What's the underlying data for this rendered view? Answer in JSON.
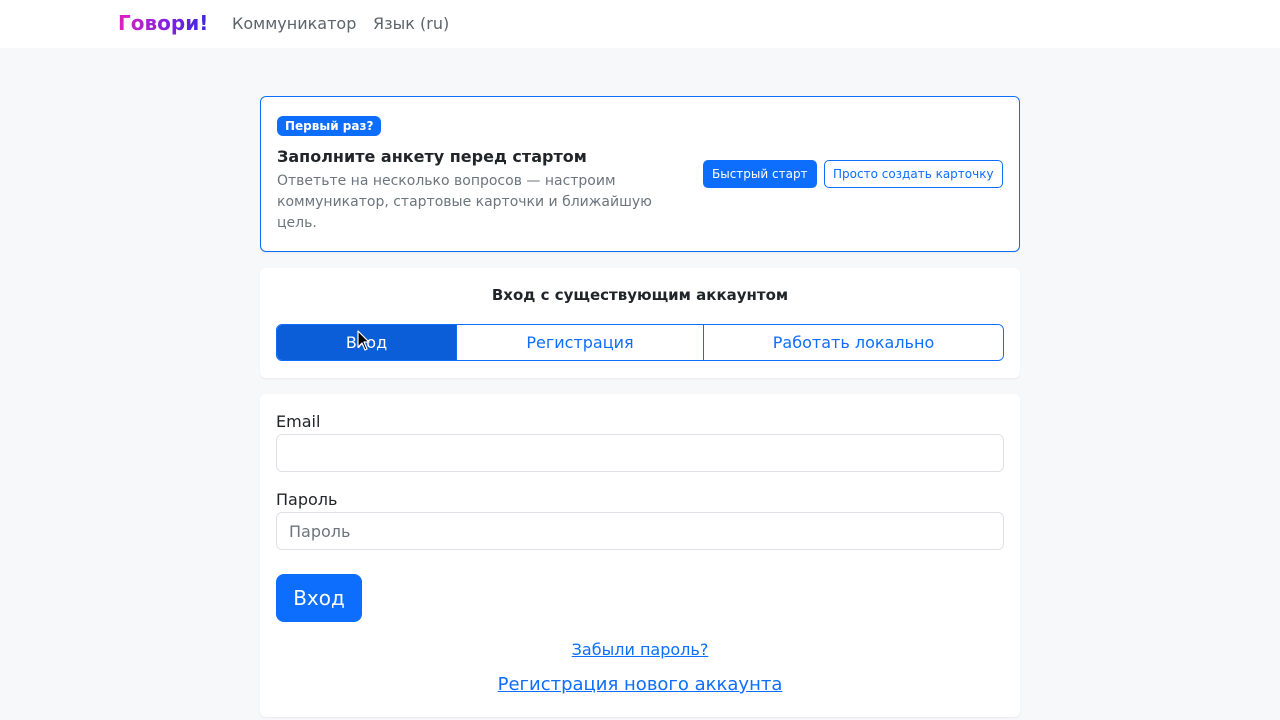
{
  "navbar": {
    "brand": "Говори!",
    "links": [
      "Коммуникатор",
      "Язык (ru)"
    ]
  },
  "onboarding": {
    "badge": "Первый раз?",
    "title": "Заполните анкету перед стартом",
    "text": "Ответьте на несколько вопросов — настроим коммуникатор, стартовые карточки и ближайшую цель.",
    "quick_start": "Быстрый старт",
    "create_card": "Просто создать карточку"
  },
  "login": {
    "title": "Вход с существующим аккаунтом",
    "tabs": [
      {
        "label": "Вход",
        "active": true
      },
      {
        "label": "Регистрация",
        "active": false
      },
      {
        "label": "Работать локально",
        "active": false
      }
    ]
  },
  "form": {
    "email_label": "Email",
    "email_value": "",
    "email_placeholder": "",
    "password_label": "Пароль",
    "password_placeholder": "Пароль",
    "submit": "Вход",
    "forgot": "Забыли пароль?",
    "register_link": "Регистрация нового аккаунта"
  },
  "colors": {
    "primary": "#0d6efd",
    "background": "#f7f8fa",
    "brand_gradient": [
      "#e020c0",
      "#3a2ad8"
    ]
  }
}
